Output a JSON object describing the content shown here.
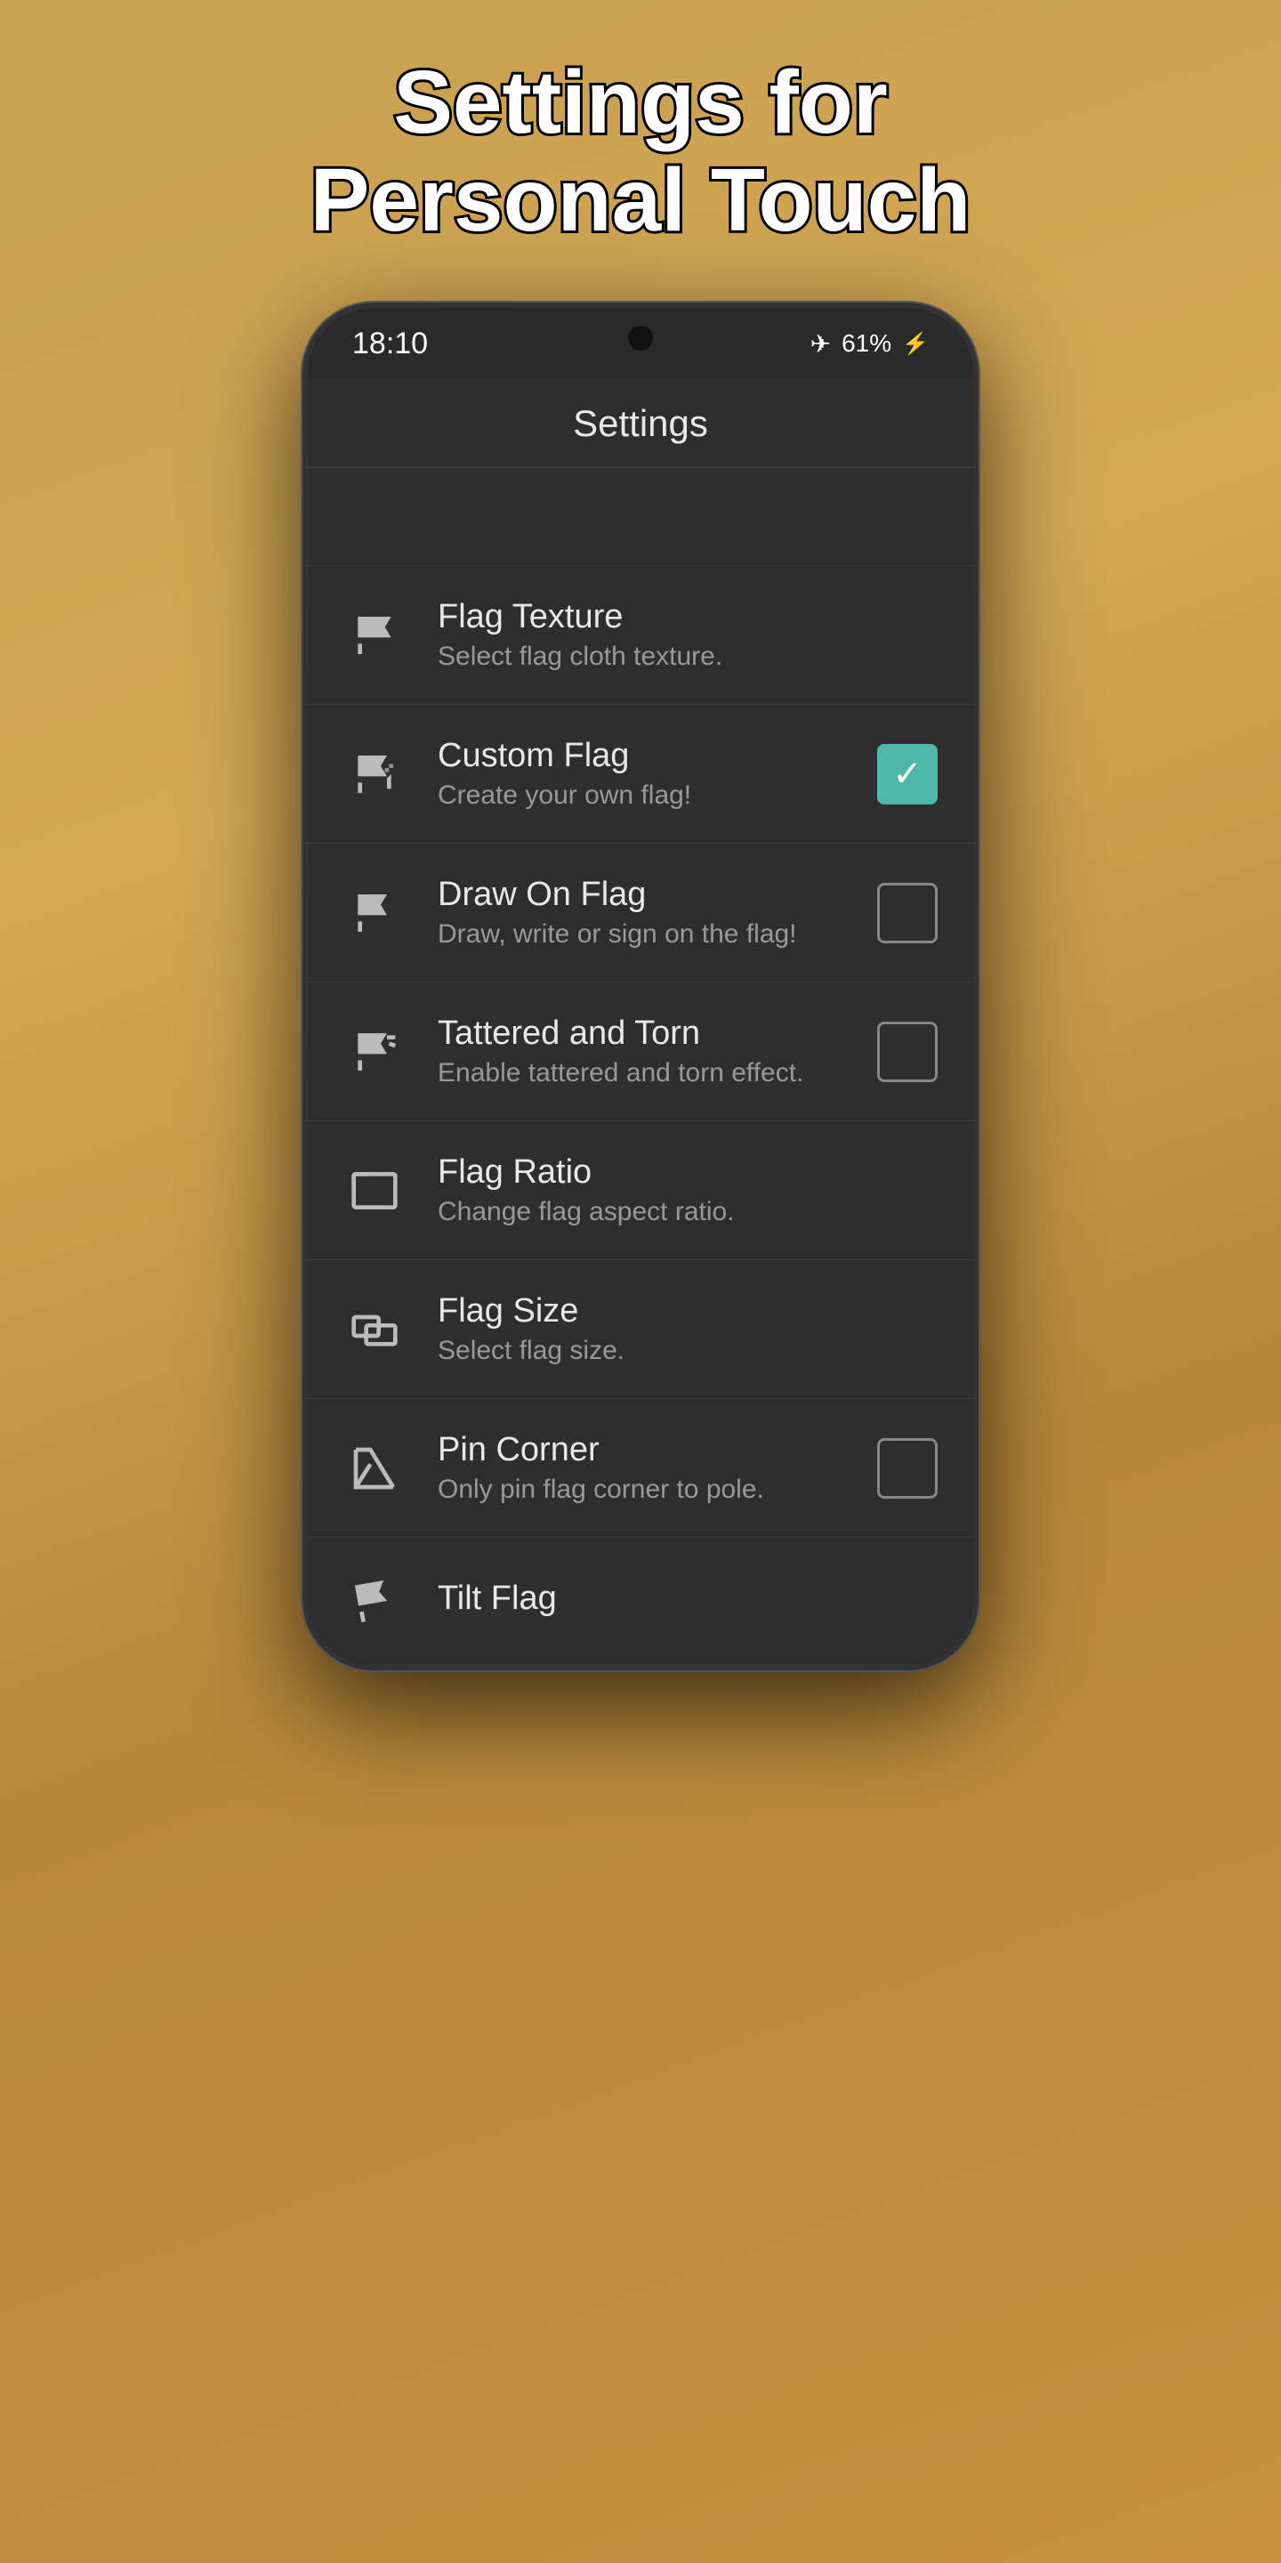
{
  "headline": {
    "line1": "Settings for",
    "line2": "Personal Touch"
  },
  "statusBar": {
    "time": "18:10",
    "battery": "61%"
  },
  "screen": {
    "title": "Settings"
  },
  "settingsItems": [
    {
      "id": "flag-texture",
      "title": "Flag Texture",
      "subtitle": "Select flag cloth texture.",
      "hasCheckbox": false,
      "checked": false
    },
    {
      "id": "custom-flag",
      "title": "Custom Flag",
      "subtitle": "Create your own flag!",
      "hasCheckbox": true,
      "checked": true
    },
    {
      "id": "draw-on-flag",
      "title": "Draw On Flag",
      "subtitle": "Draw, write or sign on the flag!",
      "hasCheckbox": true,
      "checked": false
    },
    {
      "id": "tattered-and-torn",
      "title": "Tattered and Torn",
      "subtitle": "Enable tattered and torn effect.",
      "hasCheckbox": true,
      "checked": false
    },
    {
      "id": "flag-ratio",
      "title": "Flag Ratio",
      "subtitle": "Change flag aspect ratio.",
      "hasCheckbox": false,
      "checked": false
    },
    {
      "id": "flag-size",
      "title": "Flag Size",
      "subtitle": "Select flag size.",
      "hasCheckbox": false,
      "checked": false
    },
    {
      "id": "pin-corner",
      "title": "Pin Corner",
      "subtitle": "Only pin flag corner to pole.",
      "hasCheckbox": true,
      "checked": false
    },
    {
      "id": "tilt-flag",
      "title": "Tilt Flag",
      "subtitle": "",
      "hasCheckbox": false,
      "checked": false
    }
  ]
}
